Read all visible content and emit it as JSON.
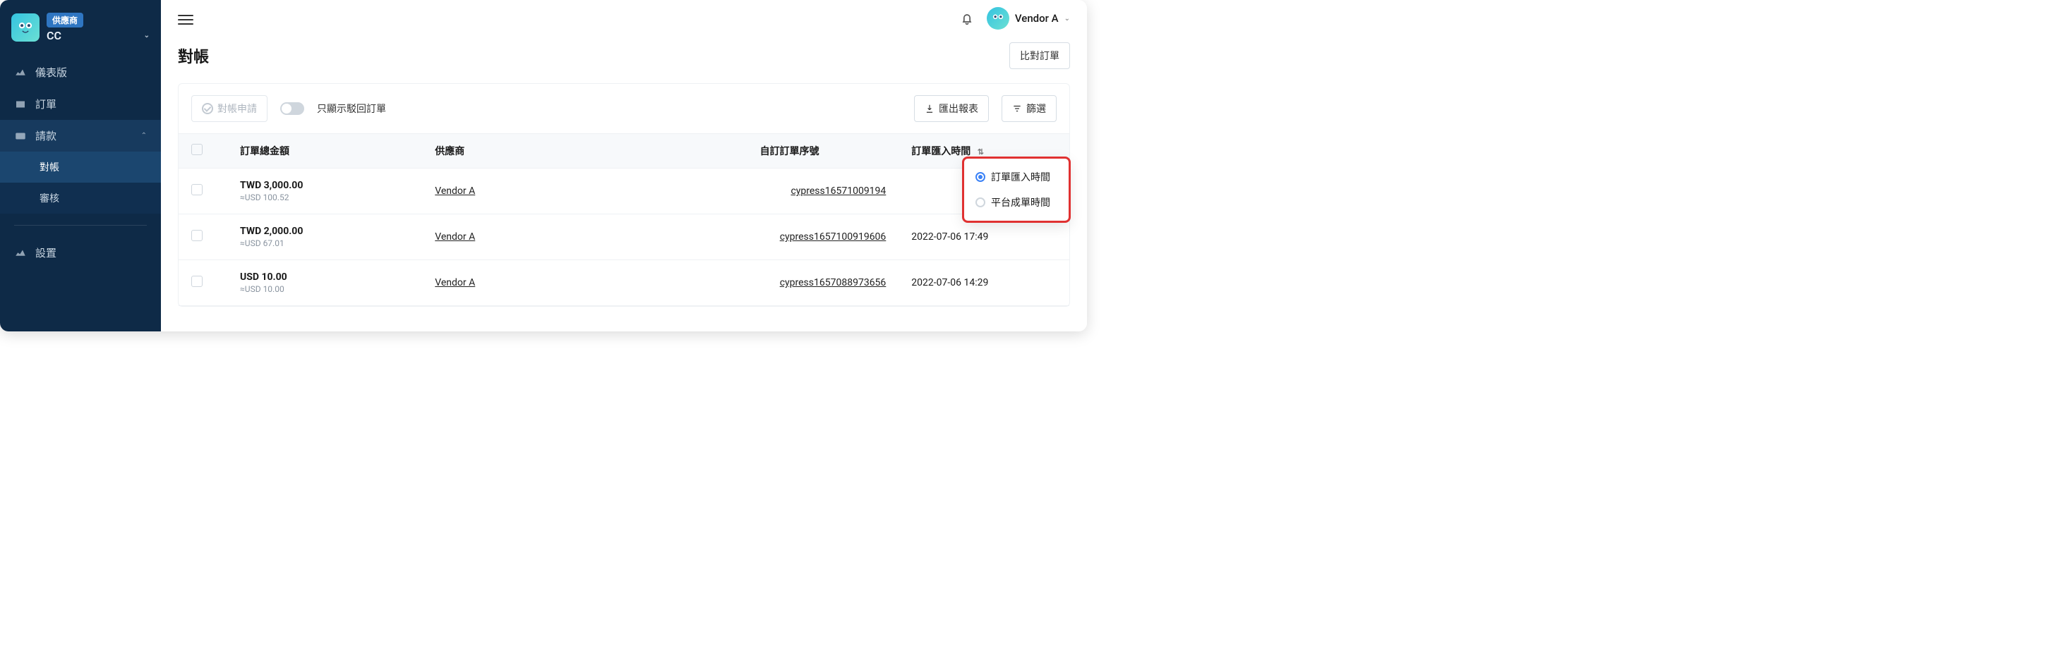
{
  "sidebar": {
    "vendor_badge": "供應商",
    "org_code": "CC",
    "items": [
      {
        "icon": "chart-icon",
        "label": "儀表版"
      },
      {
        "icon": "box-icon",
        "label": "訂單"
      },
      {
        "icon": "card-icon",
        "label": "請款",
        "expanded": true,
        "children": [
          {
            "label": "對帳",
            "selected": true
          },
          {
            "label": "審核"
          }
        ]
      },
      {
        "icon": "gear-icon",
        "label": "設置"
      }
    ]
  },
  "topbar": {
    "user_name": "Vendor A"
  },
  "page": {
    "title": "對帳",
    "compare_button": "比對訂單"
  },
  "toolbar": {
    "reconcile_request": "對帳申請",
    "show_rejected_only": "只顯示駁回訂單",
    "export_report": "匯出報表",
    "filter": "篩選"
  },
  "table": {
    "columns": {
      "amount": "訂單總金額",
      "vendor": "供應商",
      "custom_seq": "自訂訂單序號",
      "import_time": "訂單匯入時間"
    },
    "rows": [
      {
        "amount": "TWD 3,000.00",
        "amount_sub": "≈USD 100.52",
        "vendor": "Vendor A",
        "seq": "cypress16571009194",
        "time": ""
      },
      {
        "amount": "TWD 2,000.00",
        "amount_sub": "≈USD 67.01",
        "vendor": "Vendor A",
        "seq": "cypress1657100919606",
        "time": "2022-07-06 17:49"
      },
      {
        "amount": "USD 10.00",
        "amount_sub": "≈USD 10.00",
        "vendor": "Vendor A",
        "seq": "cypress1657088973656",
        "time": "2022-07-06 14:29"
      }
    ]
  },
  "popover": {
    "opt_import_time": "訂單匯入時間",
    "opt_platform_time": "平台成單時間"
  }
}
